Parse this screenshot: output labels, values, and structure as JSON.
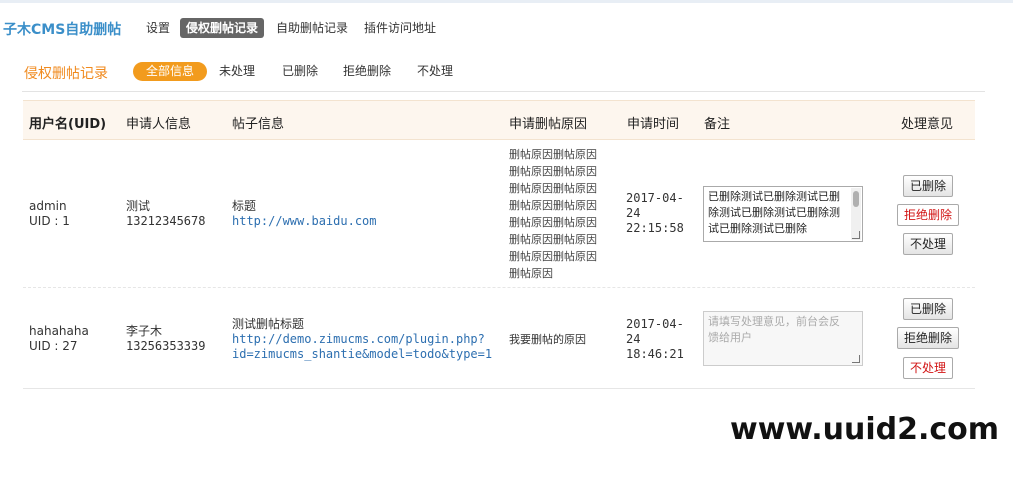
{
  "header": {
    "brand": "子木CMS自助删帖",
    "nav": [
      {
        "label": "设置"
      },
      {
        "label": "侵权删帖记录",
        "active": true
      },
      {
        "label": "自助删帖记录"
      },
      {
        "label": "插件访问地址"
      }
    ]
  },
  "subheader": {
    "title": "侵权删帖记录",
    "filters": [
      {
        "label": "全部信息",
        "active": true
      },
      {
        "label": "未处理"
      },
      {
        "label": "已删除"
      },
      {
        "label": "拒绝删除"
      },
      {
        "label": "不处理"
      }
    ]
  },
  "table": {
    "columns": [
      "用户名(UID)",
      "申请人信息",
      "帖子信息",
      "申请删帖原因",
      "申请时间",
      "备注",
      "处理意见"
    ],
    "rows": [
      {
        "username": "admin",
        "uid": "UID : 1",
        "applicant_name": "测试",
        "applicant_phone": "13212345678",
        "post_title": "标题",
        "post_url": "http://www.baidu.com",
        "reason_lines": [
          "删帖原因删帖原因",
          "删帖原因删帖原因",
          "删帖原因删帖原因",
          "删帖原因删帖原因",
          "删帖原因删帖原因",
          "删帖原因删帖原因",
          "删帖原因删帖原因",
          "删帖原因"
        ],
        "time_date": "2017-04-",
        "time_day": "24",
        "time_clock": "22:15:58",
        "memo_value": "已删除测试已删除测试已删除测试已删除测试已删除测试已删除测试已删除",
        "memo_placeholder": "",
        "actions": [
          {
            "label": "已删除",
            "selected": false
          },
          {
            "label": "拒绝删除",
            "selected": true
          },
          {
            "label": "不处理",
            "selected": false
          }
        ]
      },
      {
        "username": "hahahaha",
        "uid": "UID : 27",
        "applicant_name": "李子木",
        "applicant_phone": "13256353339",
        "post_title": "测试删帖标题",
        "post_url_1": "http://demo.zimucms.com/plugin.php?",
        "post_url_2": "id=zimucms_shantie&model=todo&type=1",
        "reason": "我要删帖的原因",
        "time_date": "2017-04-",
        "time_day": "24",
        "time_clock": "18:46:21",
        "memo_value": "",
        "memo_placeholder": "请填写处理意见，前台会反馈给用户",
        "actions": [
          {
            "label": "已删除",
            "selected": false
          },
          {
            "label": "拒绝删除",
            "selected": false
          },
          {
            "label": "不处理",
            "selected": true
          }
        ]
      }
    ]
  },
  "watermark": "www.uuid2.com",
  "colors": {
    "brand": "#3b8fc9",
    "accent_orange": "#f29b1d",
    "header_bg": "#fdf6ee",
    "link": "#2d6fb0",
    "selected_action": "#d21414"
  }
}
